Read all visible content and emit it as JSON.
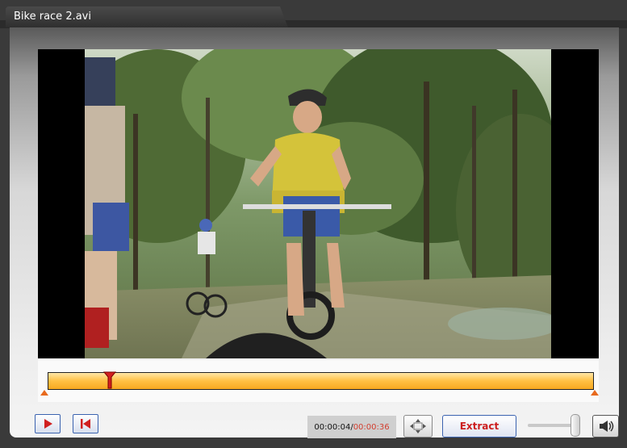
{
  "window": {
    "title": "Bike race 2.avi"
  },
  "player": {
    "time_current": "00:00:04",
    "time_separator": "/",
    "time_total": "00:00:36",
    "progress_fraction": 0.114,
    "volume_fraction": 0.95
  },
  "controls": {
    "play_icon": "play-icon",
    "rewind_icon": "skip-to-start-icon",
    "fullscreen_icon": "fullscreen-icon",
    "extract_label": "Extract",
    "speaker_icon": "speaker-icon"
  },
  "colors": {
    "timeline_fill": "#ffc043",
    "accent_red": "#cc2020",
    "button_border": "#3b63b0"
  }
}
